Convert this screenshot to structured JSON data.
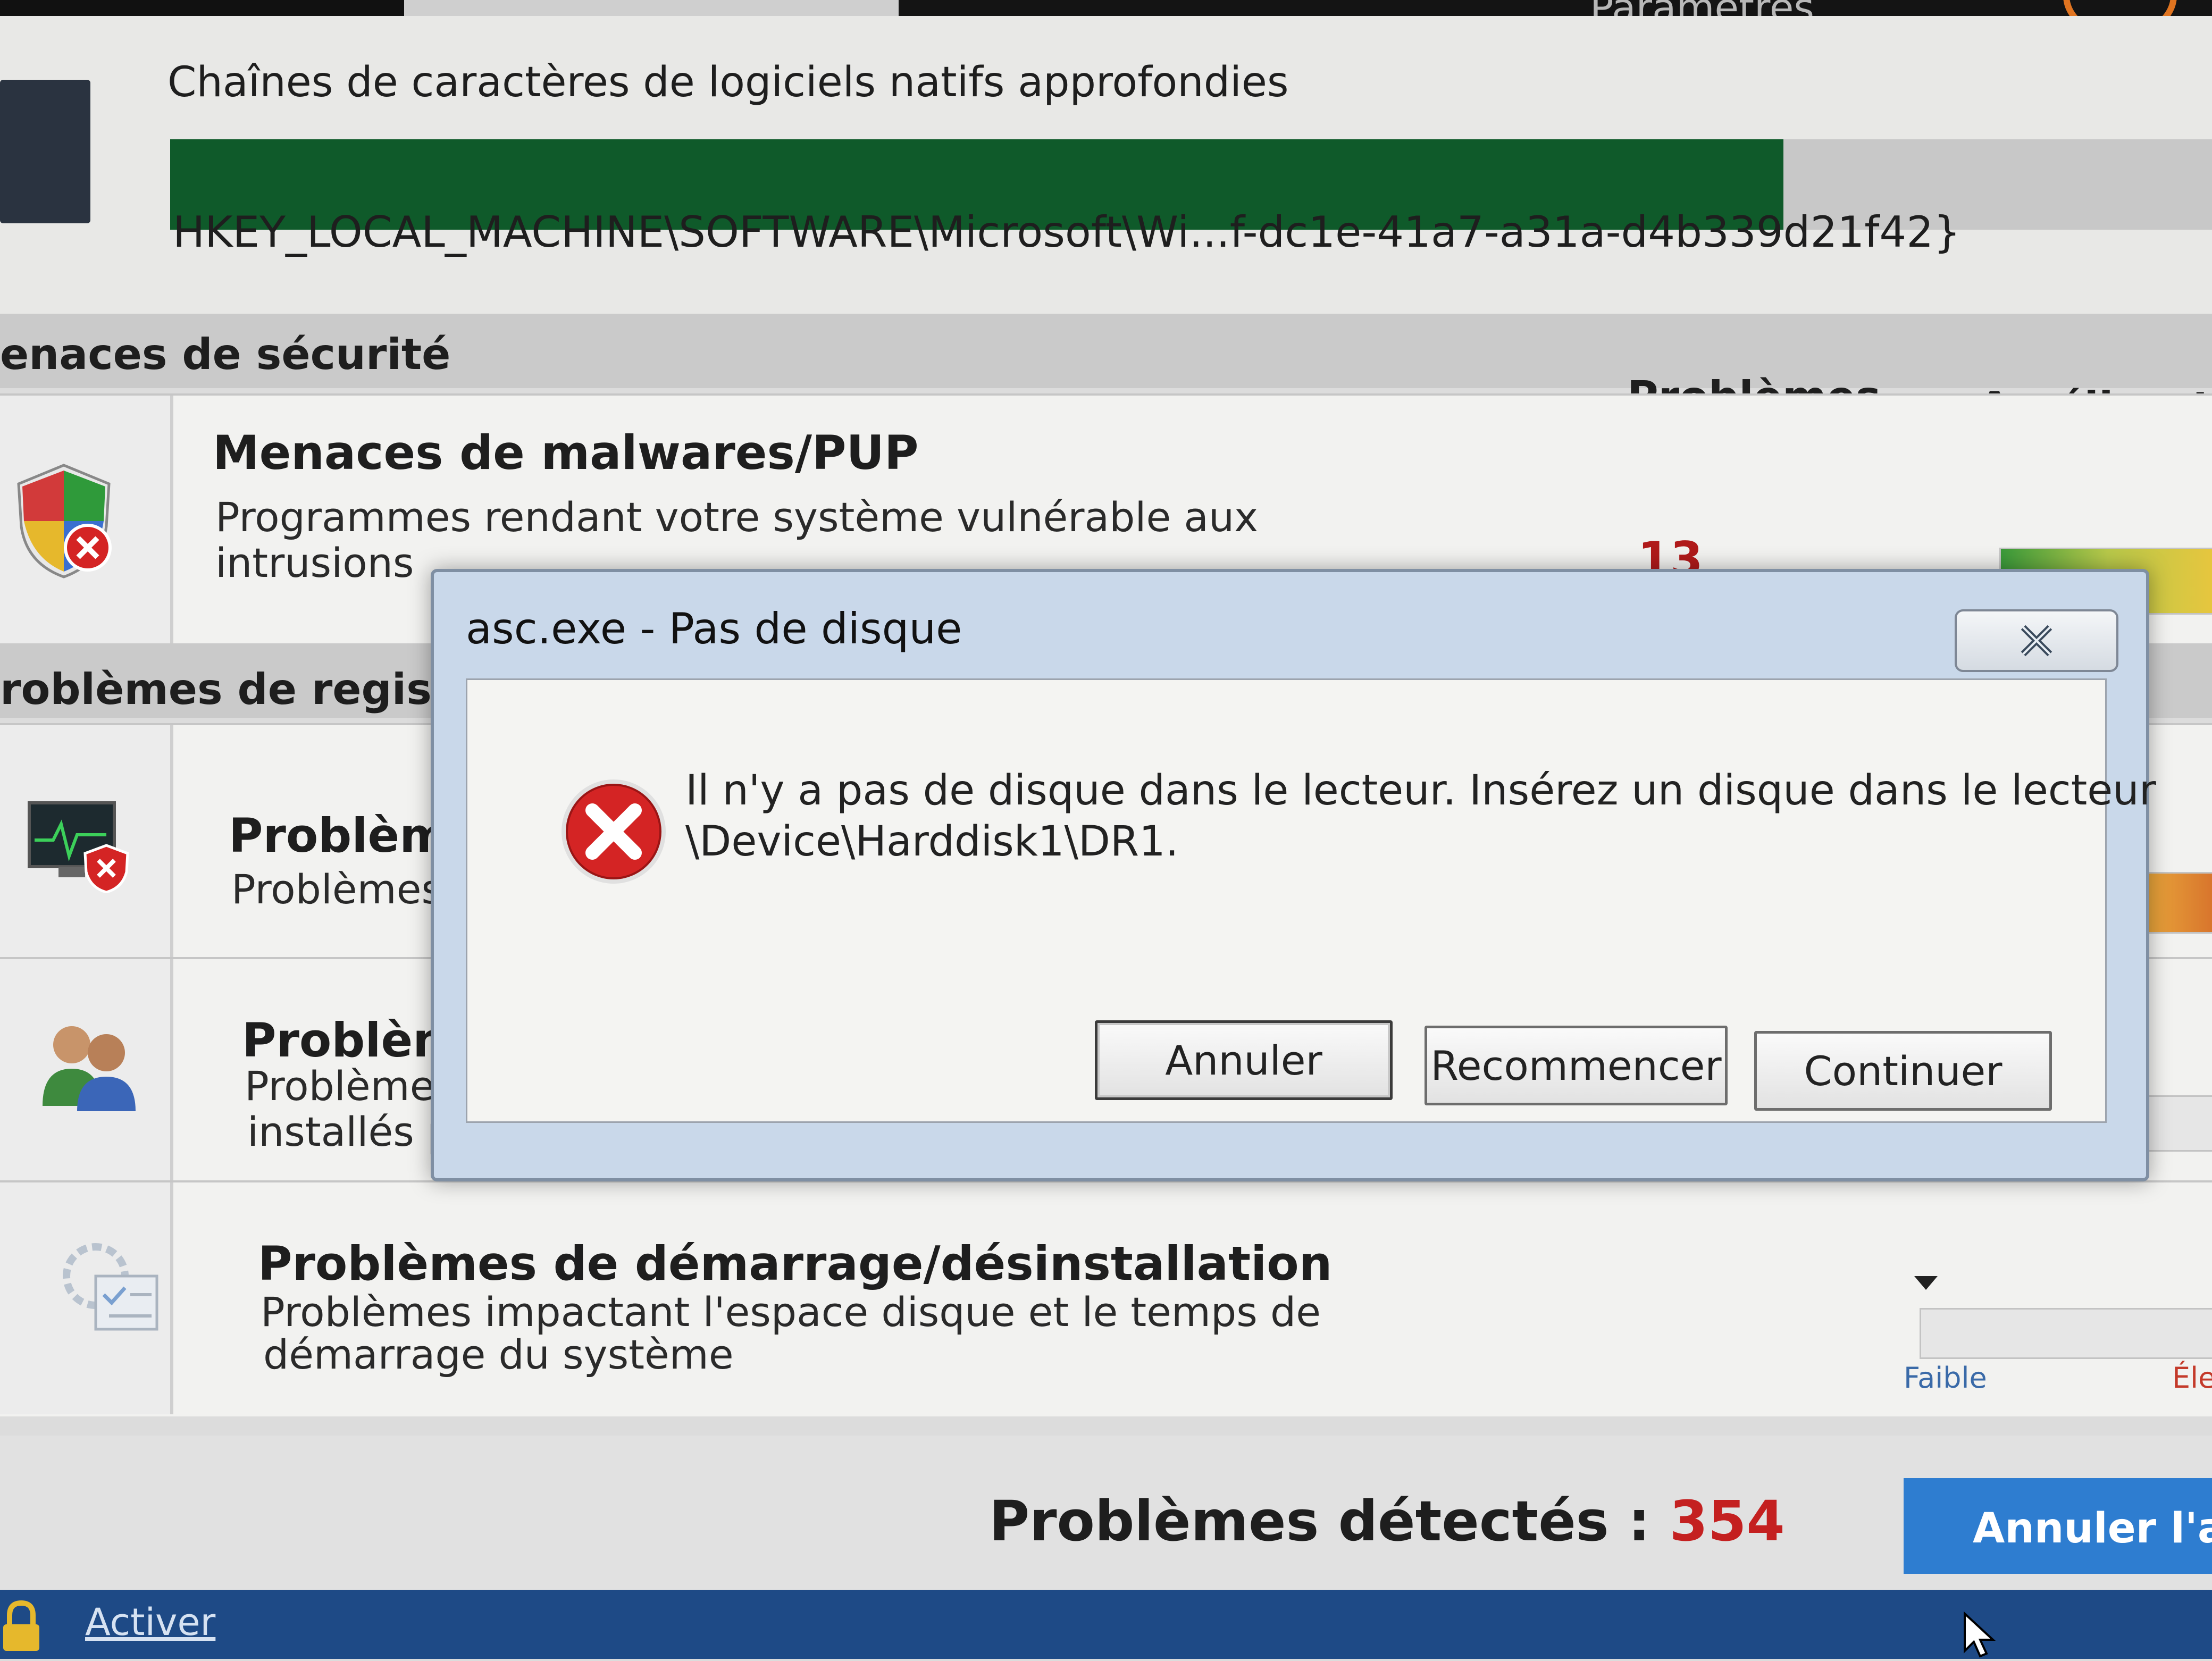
{
  "top_tab": {
    "label": "Paramètres"
  },
  "scan": {
    "title": "Chaînes de caractères de logiciels natifs approfondies",
    "progress_percent": 79,
    "current_path": "HKEY_LOCAL_MACHINE\\SOFTWARE\\Microsoft\\Wi...f-dc1e-41a7-a31a-d4b339d21f42}"
  },
  "security_section": {
    "title": "enaces de sécurité",
    "col_problems": "Problèmes",
    "col_improvement": "Amélioratior"
  },
  "malware_row": {
    "title": "Menaces de malwares/PUP",
    "desc_line1": "Programmes rendant votre système vulnérable aux",
    "desc_line2": "intrusions",
    "count": "13"
  },
  "registry_section": {
    "title": "roblèmes de registre"
  },
  "registry_row1": {
    "title": "Problèm",
    "desc": "Problèmes"
  },
  "registry_row2": {
    "title": "Problèm",
    "desc_line1": "Problèmes",
    "desc_line2": "installés pa"
  },
  "startup_row": {
    "title": "Problèmes de démarrage/désinstallation",
    "desc_line1": "Problèmes impactant l'espace disque et le temps de",
    "desc_line2": "démarrage du système",
    "scale_low": "Faible",
    "scale_high": "Éle"
  },
  "footer": {
    "detected_label": "Problèmes détectés : ",
    "detected_count": "354",
    "cancel_analysis": "Annuler l'an",
    "activate": "Activer"
  },
  "dialog": {
    "title": "asc.exe - Pas de disque",
    "message_line1": "Il n'y a pas de disque dans le lecteur. Insérez un disque dans le lecteur",
    "message_line2": "\\Device\\Harddisk1\\DR1.",
    "buttons": {
      "cancel": "Annuler",
      "retry": "Recommencer",
      "continue": "Continuer"
    }
  },
  "colors": {
    "progress": "#0f5a2a",
    "count_red": "#b01a1a",
    "cancel_analysis_bg": "#2e7dd0",
    "statusbar": "#1e4a86",
    "dialog_frame": "#c9d8ea",
    "error_red": "#d42424"
  },
  "icons": {
    "shield": "shield-icon",
    "monitor": "monitor-shield-icon",
    "users": "users-icon",
    "startup": "startup-icon",
    "error": "error-icon",
    "close": "close-icon",
    "lock": "lock-icon",
    "cursor": "mouse-cursor-icon"
  }
}
